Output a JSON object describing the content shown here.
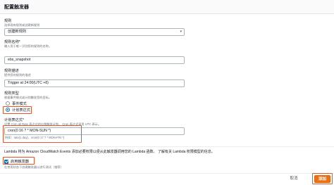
{
  "header": {
    "title": "配置触发器"
  },
  "rule": {
    "label": "规则",
    "hint": "选择现有规则或创建新规则",
    "value": "创建新规则"
  },
  "rule_name": {
    "label": "规则名称*",
    "hint": "输入用于唯一识别您的规则的名称。",
    "value": "ebs_snapshot"
  },
  "rule_desc": {
    "label": "规则描述",
    "hint": "提供您的规则的描述",
    "value": "Trigger at 24:00(UTC +8)"
  },
  "rule_type": {
    "label": "规则类型",
    "hint": "根据事件模式或计划触发您的目标。",
    "options": [
      {
        "label": "事件模式",
        "selected": false
      },
      {
        "label": "计划表达式",
        "selected": true
      }
    ]
  },
  "schedule": {
    "label": "计划表达式*",
    "hint_prefix": "设置 Cron 或 Rate 表达式的自我触发计划。 Cron 表达式采用 UTC 表示。",
    "value": "cron(0 16 ? * MON-SUN *)",
    "example_prefix": "例如：rate(1 day)、cron(0 17 ? * MON-FRI *)"
  },
  "lambda_note": "Lambda 将为 Amazon CloudWatch Events 添加必要权限以便从此触发器调用您的 Lambda 函数。 了解有关 Lambda 权限模型的信息。",
  "enable_trigger": {
    "label": "启用触发器",
    "checked": true,
    "hint": "在禁用状态下创建触发器以进行测试（推荐）"
  },
  "footer": {
    "cancel_label": "取消",
    "add_label": "添加"
  },
  "colors": {
    "highlight": "#e8542b",
    "accent": "#0073bb",
    "primary_button": "#ec7211"
  }
}
